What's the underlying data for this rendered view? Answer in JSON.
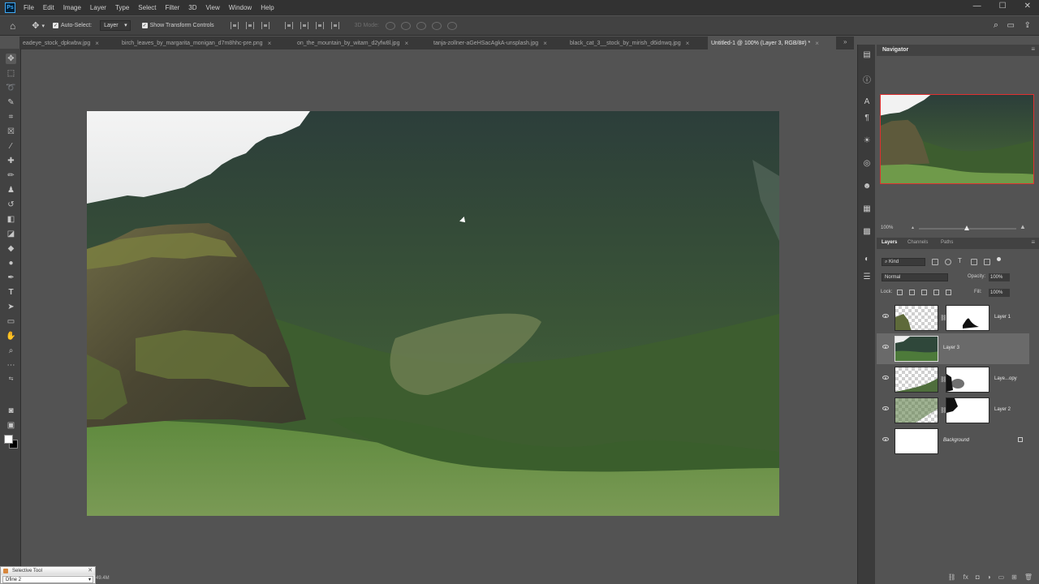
{
  "app": {
    "logo": "Ps"
  },
  "menu": [
    "File",
    "Edit",
    "Image",
    "Layer",
    "Type",
    "Select",
    "Filter",
    "3D",
    "View",
    "Window",
    "Help"
  ],
  "window_controls": {
    "minimize": "—",
    "maximize": "☐",
    "close": "✕"
  },
  "options_bar": {
    "auto_select_label": "Auto-Select:",
    "auto_select_target": "Layer",
    "show_transform_label": "Show Transform Controls",
    "mode_3d_label": "3D Mode:",
    "more_label": "•••"
  },
  "tabs": [
    {
      "label": "eadeye_stock_dpkwbw.jpg",
      "active": false
    },
    {
      "label": "birch_leaves_by_margarita_monigan_d7m8hhc-pre.png",
      "active": false
    },
    {
      "label": "on_the_mountain_by_witam_d2yfw8l.jpg",
      "active": false
    },
    {
      "label": "tanja-zollner-aGeHSacAgkA-unsplash.jpg",
      "active": false
    },
    {
      "label": "black_cat_3__stock_by_mirish_d6idnwq.jpg",
      "active": false
    },
    {
      "label": "Untitled-1 @ 100% (Layer 3, RGB/8#) *",
      "active": true
    }
  ],
  "tab_overflow": "»",
  "status_bar": {
    "doc_size": "49.4M"
  },
  "selective_tool": {
    "title": "Selective Tool",
    "close": "✕",
    "option": "Dfine 2"
  },
  "navigator": {
    "title": "Navigator",
    "zoom": "100%"
  },
  "layers_panel": {
    "tabs": [
      "Layers",
      "Channels",
      "Paths"
    ],
    "active_tab": "Layers",
    "filter_kind": "Kind",
    "blend_mode": "Normal",
    "opacity_label": "Opacity:",
    "opacity_value": "100%",
    "lock_label": "Lock:",
    "fill_label": "Fill:",
    "fill_value": "100%",
    "layers": [
      {
        "name": "Layer 1",
        "has_mask": true,
        "selected": false
      },
      {
        "name": "Layer 3",
        "has_mask": false,
        "selected": true
      },
      {
        "name": "Laye...opy",
        "has_mask": true,
        "selected": false
      },
      {
        "name": "Layer 2",
        "has_mask": true,
        "selected": false
      },
      {
        "name": "Background",
        "has_mask": false,
        "selected": false,
        "locked": true
      }
    ]
  },
  "colors": {
    "accent_blue": "#3fa9f5",
    "nav_frame": "#e03030",
    "foreground": "#ffffff",
    "background": "#000000"
  }
}
